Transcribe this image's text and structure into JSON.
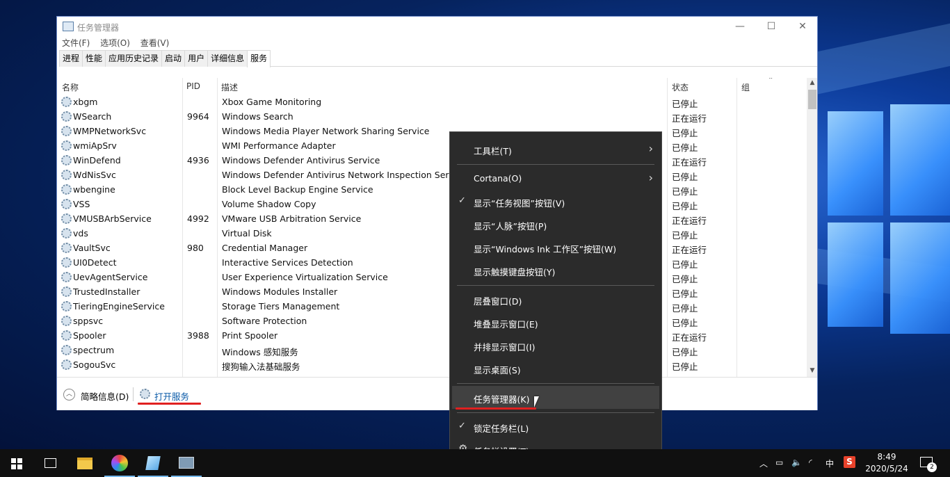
{
  "window": {
    "title": "任务管理器",
    "minimize": "—",
    "maximize": "☐",
    "close": "✕"
  },
  "menubar": [
    "文件(F)",
    "选项(O)",
    "查看(V)"
  ],
  "tabs": [
    "进程",
    "性能",
    "应用历史记录",
    "启动",
    "用户",
    "详细信息",
    "服务"
  ],
  "active_tab": "服务",
  "columns": {
    "name": "名称",
    "pid": "PID",
    "desc": "描述",
    "status": "状态",
    "group": "组"
  },
  "services": [
    {
      "name": "xbgm",
      "pid": "",
      "desc": "Xbox Game Monitoring",
      "status": "已停止"
    },
    {
      "name": "WSearch",
      "pid": "9964",
      "desc": "Windows Search",
      "status": "正在运行"
    },
    {
      "name": "WMPNetworkSvc",
      "pid": "",
      "desc": "Windows Media Player Network Sharing Service",
      "status": "已停止"
    },
    {
      "name": "wmiApSrv",
      "pid": "",
      "desc": "WMI Performance Adapter",
      "status": "已停止"
    },
    {
      "name": "WinDefend",
      "pid": "4936",
      "desc": "Windows Defender Antivirus Service",
      "status": "正在运行"
    },
    {
      "name": "WdNisSvc",
      "pid": "",
      "desc": "Windows Defender Antivirus Network Inspection Service",
      "status": "已停止"
    },
    {
      "name": "wbengine",
      "pid": "",
      "desc": "Block Level Backup Engine Service",
      "status": "已停止"
    },
    {
      "name": "VSS",
      "pid": "",
      "desc": "Volume Shadow Copy",
      "status": "已停止"
    },
    {
      "name": "VMUSBArbService",
      "pid": "4992",
      "desc": "VMware USB Arbitration Service",
      "status": "正在运行"
    },
    {
      "name": "vds",
      "pid": "",
      "desc": "Virtual Disk",
      "status": "已停止"
    },
    {
      "name": "VaultSvc",
      "pid": "980",
      "desc": "Credential Manager",
      "status": "正在运行"
    },
    {
      "name": "UI0Detect",
      "pid": "",
      "desc": "Interactive Services Detection",
      "status": "已停止"
    },
    {
      "name": "UevAgentService",
      "pid": "",
      "desc": "User Experience Virtualization Service",
      "status": "已停止"
    },
    {
      "name": "TrustedInstaller",
      "pid": "",
      "desc": "Windows Modules Installer",
      "status": "已停止"
    },
    {
      "name": "TieringEngineService",
      "pid": "",
      "desc": "Storage Tiers Management",
      "status": "已停止"
    },
    {
      "name": "sppsvc",
      "pid": "",
      "desc": "Software Protection",
      "status": "已停止"
    },
    {
      "name": "Spooler",
      "pid": "3988",
      "desc": "Print Spooler",
      "status": "正在运行"
    },
    {
      "name": "spectrum",
      "pid": "",
      "desc": "Windows 感知服务",
      "status": "已停止"
    },
    {
      "name": "SogouSvc",
      "pid": "",
      "desc": "搜狗输入法基础服务",
      "status": "已停止"
    }
  ],
  "footer": {
    "fewer_details": "简略信息(D)",
    "open_services": "打开服务"
  },
  "context_menu": [
    {
      "label": "工具栏(T)",
      "check": false,
      "submenu": true
    },
    {
      "label": "Cortana(O)",
      "check": false,
      "submenu": true
    },
    {
      "label": "显示“任务视图”按钮(V)",
      "check": true,
      "submenu": false
    },
    {
      "label": "显示“人脉”按钮(P)",
      "check": false,
      "submenu": false
    },
    {
      "label": "显示“Windows Ink 工作区”按钮(W)",
      "check": false,
      "submenu": false
    },
    {
      "label": "显示触摸键盘按钮(Y)",
      "check": false,
      "submenu": false
    },
    {
      "label": "层叠窗口(D)",
      "check": false,
      "submenu": false
    },
    {
      "label": "堆叠显示窗口(E)",
      "check": false,
      "submenu": false
    },
    {
      "label": "并排显示窗口(I)",
      "check": false,
      "submenu": false
    },
    {
      "label": "显示桌面(S)",
      "check": false,
      "submenu": false
    },
    {
      "label": "任务管理器(K)",
      "check": false,
      "submenu": false,
      "highlighted": true
    },
    {
      "label": "锁定任务栏(L)",
      "check": true,
      "submenu": false
    },
    {
      "label": "任务栏设置(T)",
      "check": false,
      "submenu": false,
      "icon": "gear-icon"
    }
  ],
  "taskbar": {
    "pinned": [
      "start-icon",
      "task-view-icon",
      "file-explorer-icon",
      "color-app-icon",
      "notepad-icon",
      "task-manager-icon"
    ],
    "tray": {
      "ime": "中",
      "time": "8:49",
      "date": "2020/5/24",
      "notifications": "2"
    }
  },
  "colors": {
    "accent": "#76b9ed",
    "red_marker": "#e02020",
    "menu_bg": "#2b2b2b"
  }
}
